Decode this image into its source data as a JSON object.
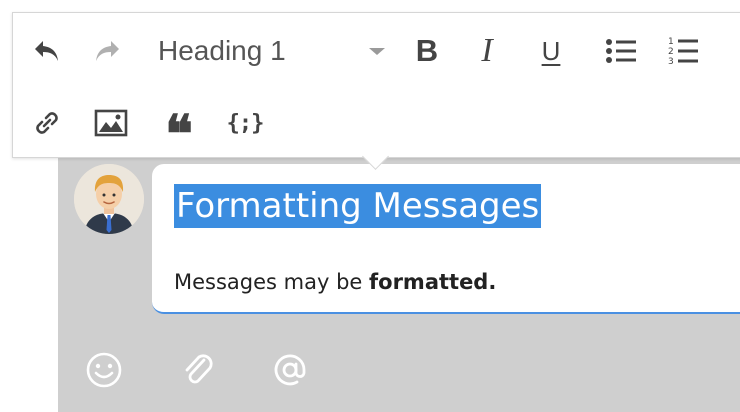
{
  "toolbar": {
    "heading_select": {
      "selected": "Heading 1"
    },
    "buttons": {
      "undo": "undo-icon",
      "redo": "redo-icon",
      "bold": "B",
      "italic": "I",
      "underline": "U",
      "bullet_list": "bullet-list-icon",
      "numbered_list": "numbered-list-icon",
      "link": "link-icon",
      "image": "image-icon",
      "quote": "❝",
      "code": "{;}"
    },
    "colors": {
      "icon": "#444444",
      "disabled_icon": "#b0b0b0"
    }
  },
  "message": {
    "heading": "Formatting Messages",
    "body_prefix": "Messages may be ",
    "body_bold": "formatted."
  },
  "composer_actions": [
    "emoji-icon",
    "attachment-icon",
    "mention-icon"
  ],
  "colors": {
    "selection": "#3b8de0",
    "focus_border": "#4a90e2",
    "chat_background": "#cfcfcf"
  }
}
